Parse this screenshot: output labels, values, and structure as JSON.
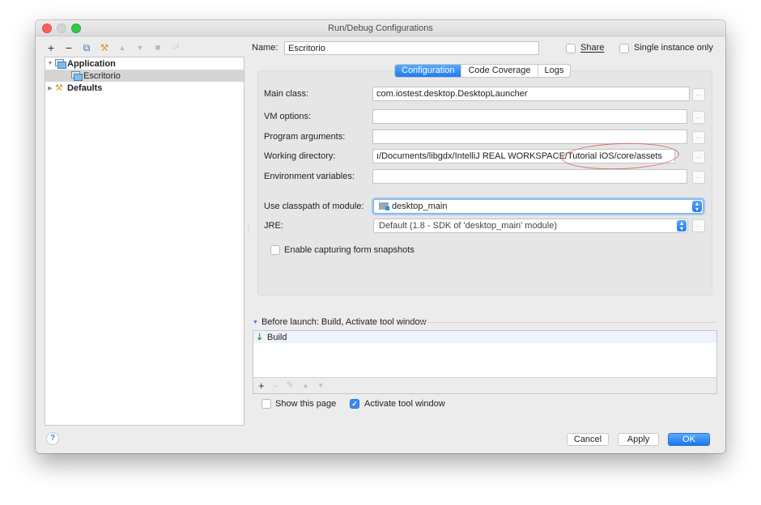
{
  "window": {
    "title": "Run/Debug Configurations"
  },
  "toolbar": {
    "icons": [
      "add-icon",
      "remove-icon",
      "copy-icon",
      "wrench-icon",
      "move-up-icon",
      "move-down-icon",
      "folder-icon",
      "sort-icon"
    ],
    "add": "+",
    "remove": "−",
    "copy": "⧉",
    "edit_defaults": "⚒",
    "move_up": "▲",
    "move_down": "▼",
    "folder": "■",
    "sort": "↓ᶻ"
  },
  "tree": {
    "items": [
      {
        "label": "Application",
        "expanded": true,
        "bold": true,
        "level": 0
      },
      {
        "label": "Escritorio",
        "selected": true,
        "level": 1
      },
      {
        "label": "Defaults",
        "expanded": false,
        "bold": true,
        "level": 0
      }
    ]
  },
  "header": {
    "name_label": "Name:",
    "name_value": "Escritorio",
    "share_label": "Share",
    "share_checked": false,
    "single_instance_label": "Single instance only",
    "single_instance_checked": false
  },
  "tabs": [
    {
      "label": "Configuration",
      "active": true
    },
    {
      "label": "Code Coverage",
      "active": false
    },
    {
      "label": "Logs",
      "active": false
    }
  ],
  "config": {
    "main_class_label": "Main class:",
    "main_class_value": "com.iostest.desktop.DesktopLauncher",
    "vm_options_label": "VM options:",
    "vm_options_value": "",
    "program_args_label": "Program arguments:",
    "program_args_value": "",
    "working_dir_label": "Working directory:",
    "working_dir_value": "ı/Documents/libgdx/IntelliJ REAL WORKSPACE/Tutorial iOS/core/assets",
    "env_vars_label": "Environment variables:",
    "env_vars_value": "",
    "classpath_label": "Use classpath of module:",
    "classpath_value": "desktop_main",
    "jre_label": "JRE:",
    "jre_value": "Default (1.8 - SDK of 'desktop_main' module)",
    "snapshots_label": "Enable capturing form snapshots",
    "snapshots_checked": false,
    "browse_label": "..."
  },
  "before_launch": {
    "header": "Before launch: Build, Activate tool window",
    "items": [
      "Build"
    ],
    "toolbar": {
      "add": "+",
      "remove": "−",
      "edit": "✎",
      "up": "▲",
      "down": "▼"
    },
    "show_page_label": "Show this page",
    "show_page_checked": false,
    "activate_tool_label": "Activate tool window",
    "activate_tool_checked": true
  },
  "footer": {
    "help": "?",
    "cancel": "Cancel",
    "apply": "Apply",
    "ok": "OK"
  },
  "annotation": {
    "highlight_color": "#e36a6a",
    "highlighted_text": "Tutorial iOS/core/assets"
  }
}
